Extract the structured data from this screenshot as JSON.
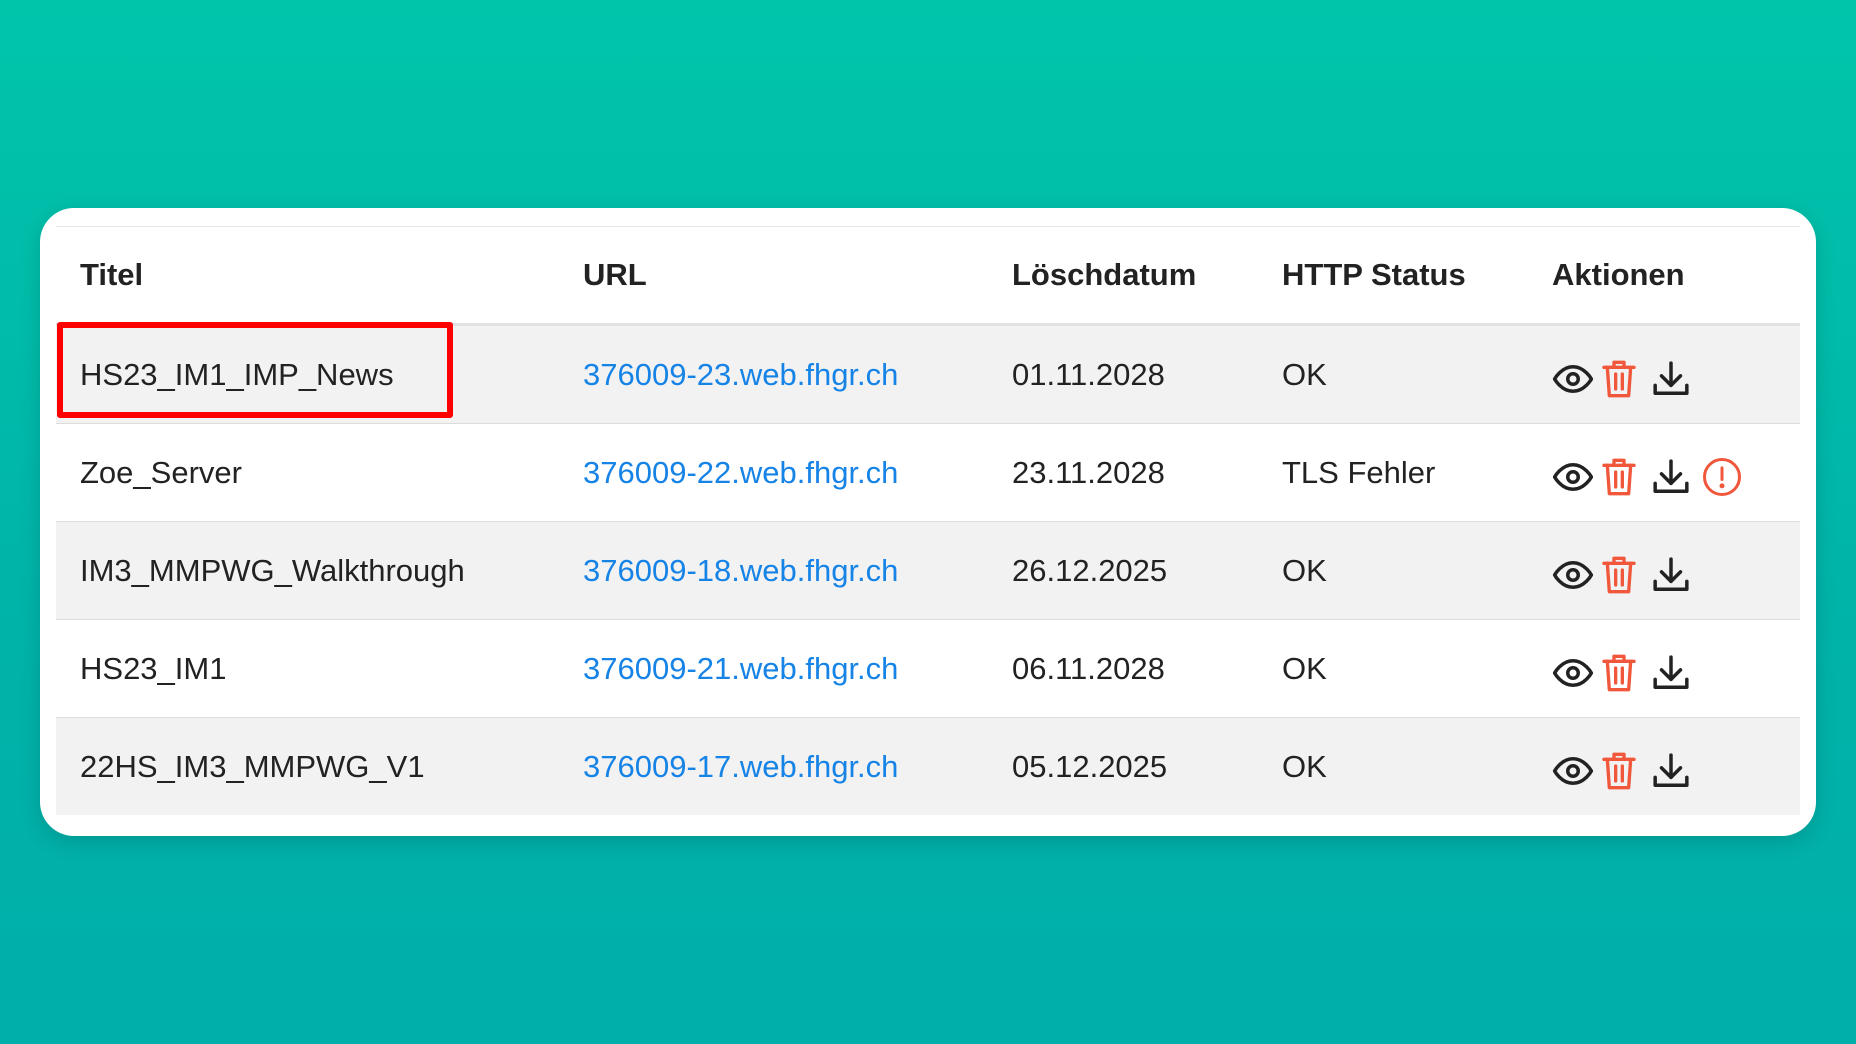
{
  "table": {
    "headers": {
      "title": "Titel",
      "url": "URL",
      "delete_date": "Löschdatum",
      "http_status": "HTTP Status",
      "actions": "Aktionen"
    },
    "rows": [
      {
        "title": "HS23_IM1_IMP_News",
        "url": "376009-23.web.fhgr.ch",
        "delete_date": "01.11.2028",
        "http_status": "OK",
        "warning": false,
        "highlighted": true
      },
      {
        "title": "Zoe_Server",
        "url": "376009-22.web.fhgr.ch",
        "delete_date": "23.11.2028",
        "http_status": "TLS Fehler",
        "warning": true,
        "highlighted": false
      },
      {
        "title": "IM3_MMPWG_Walkthrough",
        "url": "376009-18.web.fhgr.ch",
        "delete_date": "26.12.2025",
        "http_status": "OK",
        "warning": false,
        "highlighted": false
      },
      {
        "title": "HS23_IM1",
        "url": "376009-21.web.fhgr.ch",
        "delete_date": "06.11.2028",
        "http_status": "OK",
        "warning": false,
        "highlighted": false
      },
      {
        "title": "22HS_IM3_MMPWG_V1",
        "url": "376009-17.web.fhgr.ch",
        "delete_date": "05.12.2025",
        "http_status": "OK",
        "warning": false,
        "highlighted": false
      }
    ],
    "action_icons": [
      "eye-icon",
      "trash-icon",
      "download-icon"
    ],
    "warning_icon": "exclamation-circle-icon"
  },
  "colors": {
    "background": "#00c0ab",
    "link": "#1683e6",
    "delete": "#f0573b",
    "warning": "#f0573b",
    "highlight": "#ff0000",
    "stripe": "#f2f2f2"
  }
}
